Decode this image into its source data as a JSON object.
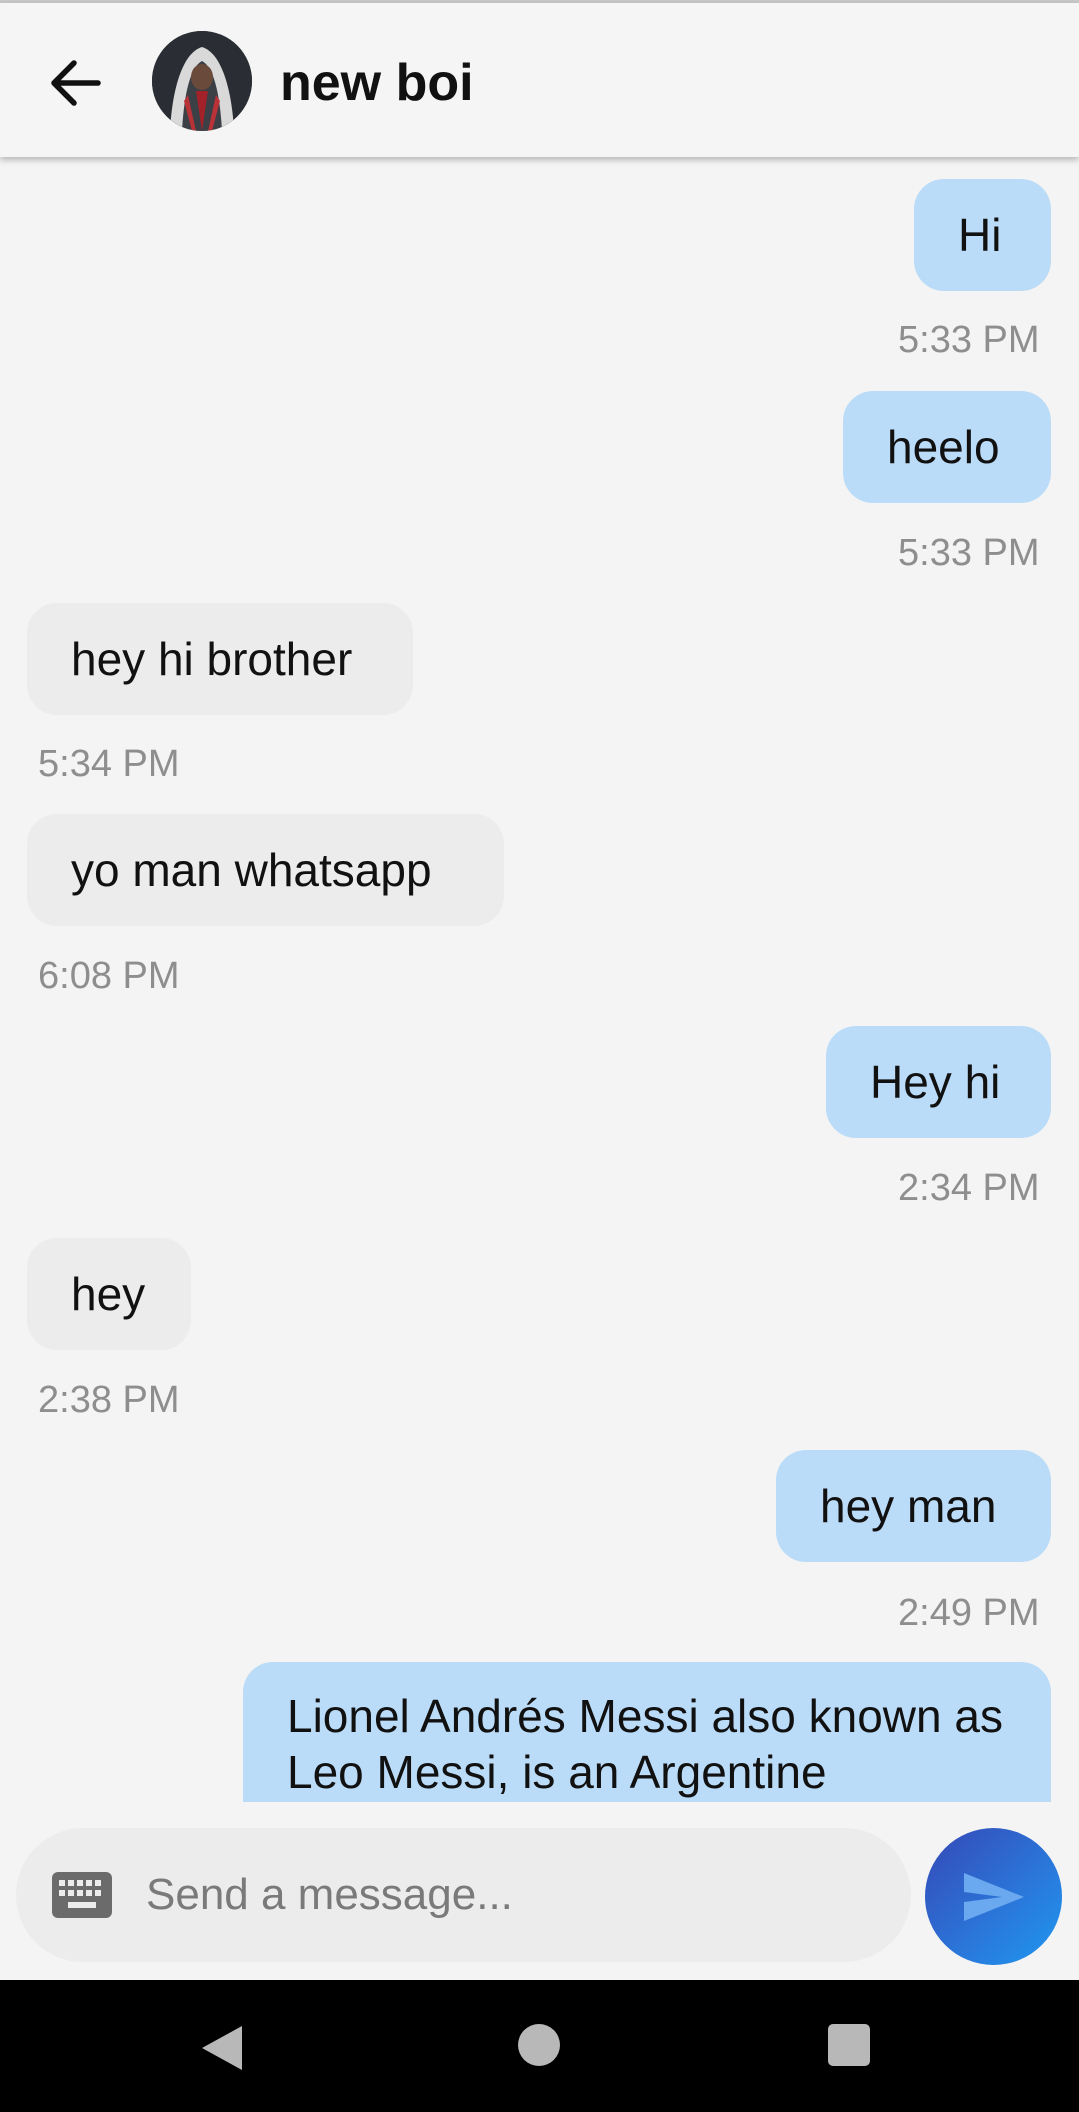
{
  "header": {
    "title": "new boi",
    "back_icon": "arrow-left-icon",
    "avatar_alt": "contact avatar"
  },
  "messages": [
    {
      "text": "Hi",
      "time": "5:33 PM",
      "direction": "outgoing"
    },
    {
      "text": "heelo",
      "time": "5:33 PM",
      "direction": "outgoing"
    },
    {
      "text": "hey hi brother",
      "time": "5:34 PM",
      "direction": "incoming"
    },
    {
      "text": "yo man whatsapp",
      "time": "6:08 PM",
      "direction": "incoming"
    },
    {
      "text": "Hey hi",
      "time": "2:34 PM",
      "direction": "outgoing"
    },
    {
      "text": "hey",
      "time": "2:38 PM",
      "direction": "incoming"
    },
    {
      "text": "hey man",
      "time": "2:49 PM",
      "direction": "outgoing"
    },
    {
      "text": "Lionel Andrés Messi also known as Leo Messi, is an Argentine",
      "time": "",
      "direction": "outgoing"
    }
  ],
  "composer": {
    "placeholder": "Send a message...",
    "value": "",
    "keyboard_icon": "keyboard-icon",
    "send_icon": "send-icon"
  },
  "colors": {
    "outgoing_bubble": "#bbdcf8",
    "incoming_bubble": "#ececec",
    "send_button_start": "#3548b6",
    "send_button_end": "#1f98f0",
    "background": "#f4f4f4"
  },
  "system_nav": {
    "back_icon": "nav-back-icon",
    "home_icon": "nav-home-icon",
    "recents_icon": "nav-recents-icon"
  }
}
